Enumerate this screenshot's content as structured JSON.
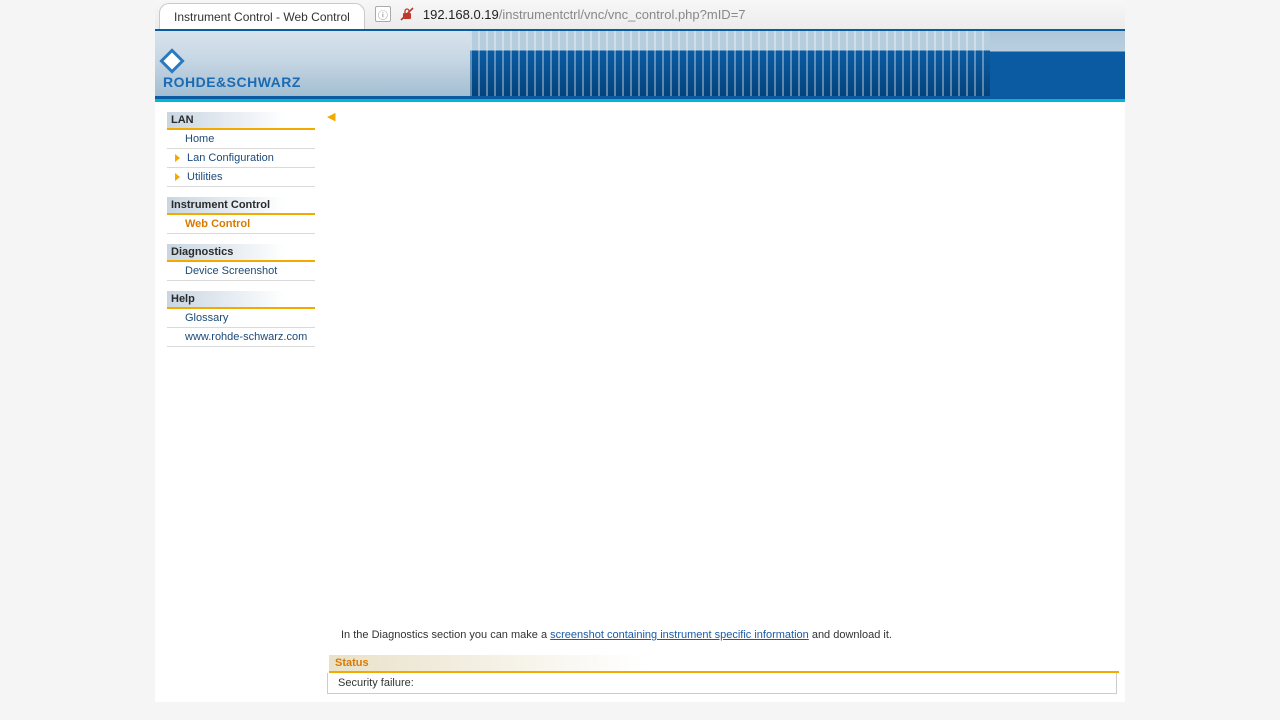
{
  "browser": {
    "tab_title": "Instrument Control - Web Control",
    "url_host": "192.168.0.19",
    "url_path": "/instrumentctrl/vnc/vnc_control.php?mID=7"
  },
  "logo_text": "ROHDE&SCHWARZ",
  "sidebar": {
    "groups": [
      {
        "label": "LAN",
        "items": [
          {
            "label": "Home",
            "expandable": false,
            "active": false
          },
          {
            "label": "Lan Configuration",
            "expandable": true,
            "active": false
          },
          {
            "label": "Utilities",
            "expandable": true,
            "active": false
          }
        ]
      },
      {
        "label": "Instrument Control",
        "items": [
          {
            "label": "Web Control",
            "expandable": false,
            "active": true
          }
        ]
      },
      {
        "label": "Diagnostics",
        "items": [
          {
            "label": "Device Screenshot",
            "expandable": false,
            "active": false
          }
        ]
      },
      {
        "label": "Help",
        "items": [
          {
            "label": "Glossary",
            "expandable": false,
            "active": false
          },
          {
            "label": "www.rohde-schwarz.com",
            "expandable": false,
            "active": false
          }
        ]
      }
    ]
  },
  "content": {
    "diag_note_prefix": "In the Diagnostics section you can make a ",
    "diag_note_link": "screenshot containing instrument specific information",
    "diag_note_suffix": " and download it.",
    "status_header": "Status",
    "status_message": "Security failure:"
  }
}
